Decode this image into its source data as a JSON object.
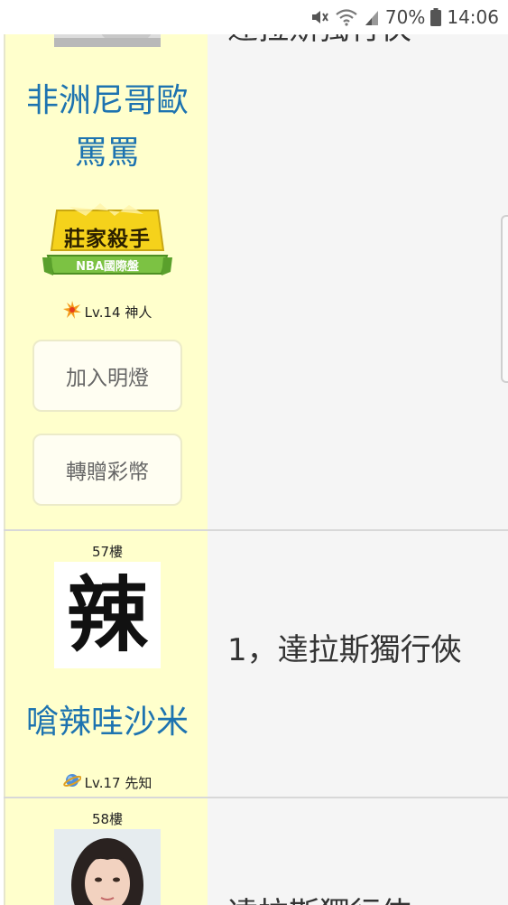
{
  "status_bar": {
    "battery": "70%",
    "time": "14:06",
    "icons": [
      "mute-icon",
      "wifi-icon",
      "signal-icon",
      "battery-icon"
    ]
  },
  "posts": [
    {
      "username_lines": [
        "非洲尼哥歐",
        "罵罵"
      ],
      "badge": {
        "title": "莊家殺手",
        "subtitle": "NBA國際盤"
      },
      "level": "Lv.14 神人",
      "level_icon": "star-burst-icon",
      "buttons": {
        "add_lamp": "加入明燈",
        "transfer_coins": "轉贈彩幣"
      },
      "content": "達拉斯獨行俠"
    },
    {
      "floor": "57樓",
      "avatar_char": "辣",
      "username": "嗆辣哇沙米",
      "level": "Lv.17 先知",
      "level_icon": "planet-icon",
      "content": "1，達拉斯獨行俠"
    },
    {
      "floor": "58樓",
      "content": "達拉斯獨行俠"
    }
  ],
  "colors": {
    "left_panel": "#ffffcc",
    "username": "#1d73b0",
    "content_bg": "#f5f5f5"
  }
}
